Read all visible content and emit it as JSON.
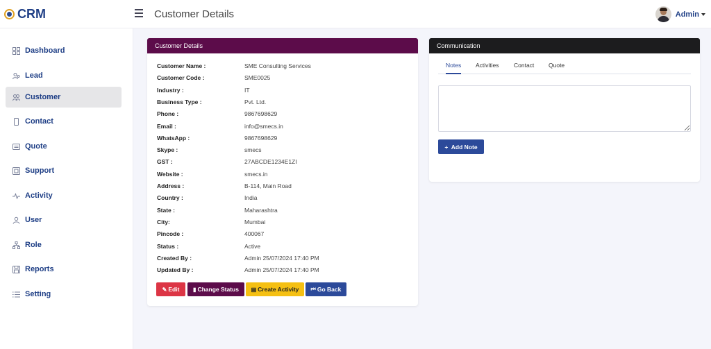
{
  "brand": {
    "name": "CRM"
  },
  "header": {
    "title": "Customer Details",
    "user_name": "Admin"
  },
  "sidebar": {
    "items": [
      {
        "label": "Dashboard",
        "icon": "grid-icon"
      },
      {
        "label": "Lead",
        "icon": "users-icon"
      },
      {
        "label": "Customer",
        "icon": "users-icon",
        "active": true
      },
      {
        "label": "Contact",
        "icon": "phone-icon"
      },
      {
        "label": "Quote",
        "icon": "document-icon"
      },
      {
        "label": "Support",
        "icon": "support-icon"
      },
      {
        "label": "Activity",
        "icon": "pulse-icon"
      },
      {
        "label": "User",
        "icon": "user-icon"
      },
      {
        "label": "Role",
        "icon": "hierarchy-icon"
      },
      {
        "label": "Reports",
        "icon": "save-icon"
      },
      {
        "label": "Setting",
        "icon": "list-icon"
      }
    ]
  },
  "customer_card": {
    "title": "Customer Details",
    "fields": [
      {
        "label": "Customer Name :",
        "value": "SME Consulting Services"
      },
      {
        "label": "Customer Code :",
        "value": "SME0025"
      },
      {
        "label": "Industry :",
        "value": "IT"
      },
      {
        "label": "Business Type :",
        "value": "Pvt. Ltd."
      },
      {
        "label": "Phone :",
        "value": "9867698629"
      },
      {
        "label": "Email :",
        "value": "info@smecs.in"
      },
      {
        "label": "WhatsApp :",
        "value": "9867698629"
      },
      {
        "label": "Skype :",
        "value": "smecs"
      },
      {
        "label": "GST :",
        "value": "27ABCDE1234E1ZI"
      },
      {
        "label": "Website :",
        "value": "smecs.in"
      },
      {
        "label": "Address :",
        "value": "B-114, Main Road"
      },
      {
        "label": "Country :",
        "value": "India"
      },
      {
        "label": "State :",
        "value": "Maharashtra"
      },
      {
        "label": "City:",
        "value": "Mumbai"
      },
      {
        "label": "Pincode :",
        "value": "400067"
      },
      {
        "label": "Status :",
        "value": "Active"
      },
      {
        "label": "Created By :",
        "value": "Admin 25/07/2024 17:40 PM"
      },
      {
        "label": "Updated By :",
        "value": "Admin 25/07/2024 17:40 PM"
      }
    ],
    "buttons": {
      "edit": "Edit",
      "change_status": "Change Status",
      "create_activity": "Create Activity",
      "go_back": "Go Back"
    }
  },
  "communication_card": {
    "title": "Communication",
    "tabs": [
      "Notes",
      "Activities",
      "Contact",
      "Quote"
    ],
    "active_tab": "Notes",
    "note_value": "",
    "add_note_label": "Add Note"
  },
  "colors": {
    "brand_blue": "#1f3f86",
    "customer_header": "#5c0c4a",
    "communication_header": "#1c1c1e",
    "edit": "#dc3545",
    "activity": "#f5c013",
    "back": "#2c4a9a"
  }
}
